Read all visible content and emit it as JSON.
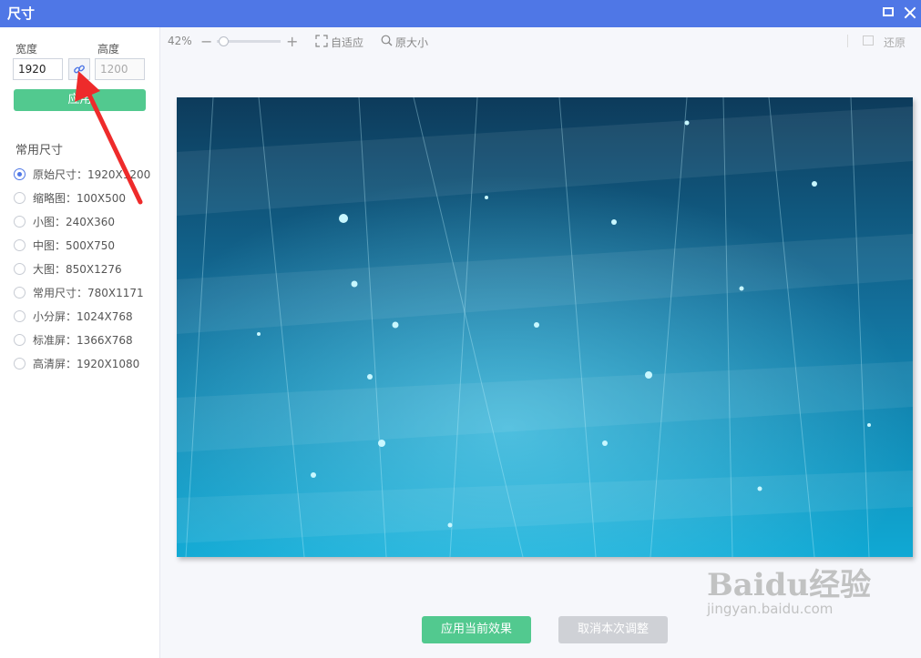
{
  "window": {
    "title": "尺寸"
  },
  "sidebar": {
    "width_label": "宽度",
    "height_label": "高度",
    "width_value": "1920",
    "height_value": "1200",
    "apply_label": "应用",
    "common_sizes_title": "常用尺寸",
    "sizes": [
      {
        "label": "原始尺寸：1920X1200",
        "selected": true
      },
      {
        "label": "缩略图：100X500",
        "selected": false
      },
      {
        "label": "小图：240X360",
        "selected": false
      },
      {
        "label": "中图：500X750",
        "selected": false
      },
      {
        "label": "大图：850X1276",
        "selected": false
      },
      {
        "label": "常用尺寸：780X1171",
        "selected": false
      },
      {
        "label": "小分屏：1024X768",
        "selected": false
      },
      {
        "label": "标准屏：1366X768",
        "selected": false
      },
      {
        "label": "高清屏：1920X1080",
        "selected": false
      }
    ]
  },
  "toolbar": {
    "zoom": "42%",
    "zoom_out": "−",
    "zoom_in": "+",
    "fit_label": "自适应",
    "original_label": "原大小",
    "restore_label": "还原"
  },
  "actions": {
    "apply_current": "应用当前效果",
    "cancel": "取消本次调整"
  },
  "watermark": {
    "brand": "Baidu经验",
    "url": "jingyan.baidu.com"
  },
  "colors": {
    "titlebar": "#4f77e6",
    "green": "#52c98f",
    "disabled": "#cfd1d6"
  }
}
